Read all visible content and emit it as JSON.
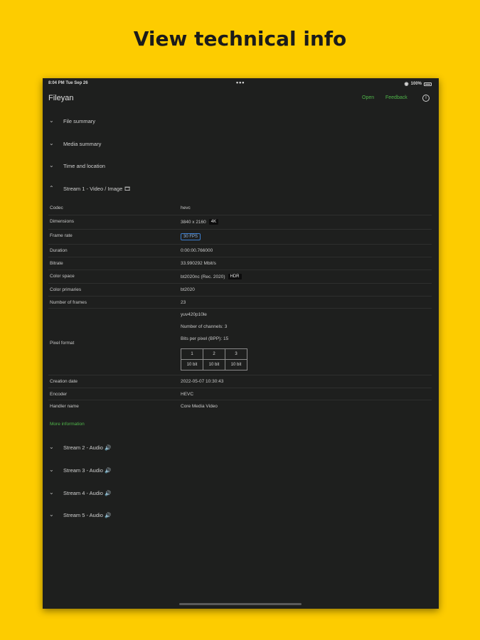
{
  "headline": "View technical info",
  "status_bar": {
    "time": "8:04 PM   Tue Sep 26",
    "dots": "•••",
    "wifi": "◉",
    "battery": "100%"
  },
  "nav": {
    "title": "Fileyan",
    "open": "Open",
    "feedback": "Feedback",
    "info_icon": "i"
  },
  "sections_top": [
    {
      "label": "File summary",
      "state": "collapsed"
    },
    {
      "label": "Media summary",
      "state": "collapsed"
    },
    {
      "label": "Time and location",
      "state": "collapsed"
    },
    {
      "label": "Stream 1 - Video / Image 🎞",
      "state": "expanded"
    }
  ],
  "chevrons": {
    "collapsed": "⌄",
    "expanded": "⌃"
  },
  "stream1": {
    "codec": {
      "key": "Codec",
      "value": "hevc"
    },
    "dimensions": {
      "key": "Dimensions",
      "value": "3840 x 2160",
      "tag": "4K"
    },
    "frame_rate": {
      "key": "Frame rate",
      "value": "30 FPS"
    },
    "duration": {
      "key": "Duration",
      "value": "0:00:00.766000"
    },
    "bitrate": {
      "key": "Bitrate",
      "value": "33.990292 Mbit/s"
    },
    "color_space": {
      "key": "Color space",
      "value": "bt2020nc (Rec. 2020)",
      "tag": "HDR"
    },
    "color_primaries": {
      "key": "Color primaries",
      "value": "bt2020"
    },
    "frames": {
      "key": "Number of frames",
      "value": "23"
    },
    "pixel_format": {
      "key": "Pixel format",
      "name": "yuv420p10le",
      "channels": "Number of channels: 3",
      "bpp": "Bits per pixel (BPP): 15",
      "headers": [
        "1",
        "2",
        "3"
      ],
      "bits": [
        "10 bit",
        "10 bit",
        "10 bit"
      ]
    },
    "creation_date": {
      "key": "Creation date",
      "value": "2022-05-07 10:30:43"
    },
    "encoder": {
      "key": "Encoder",
      "value": "HEVC"
    },
    "handler_name": {
      "key": "Handler name",
      "value": "Core Media Video"
    }
  },
  "more_info": "More information",
  "sections_bottom": [
    {
      "label": "Stream 2 - Audio 🔊",
      "state": "collapsed"
    },
    {
      "label": "Stream 3 - Audio 🔊",
      "state": "collapsed"
    },
    {
      "label": "Stream 4 - Audio 🔊",
      "state": "collapsed"
    },
    {
      "label": "Stream 5 - Audio 🔊",
      "state": "collapsed"
    }
  ]
}
